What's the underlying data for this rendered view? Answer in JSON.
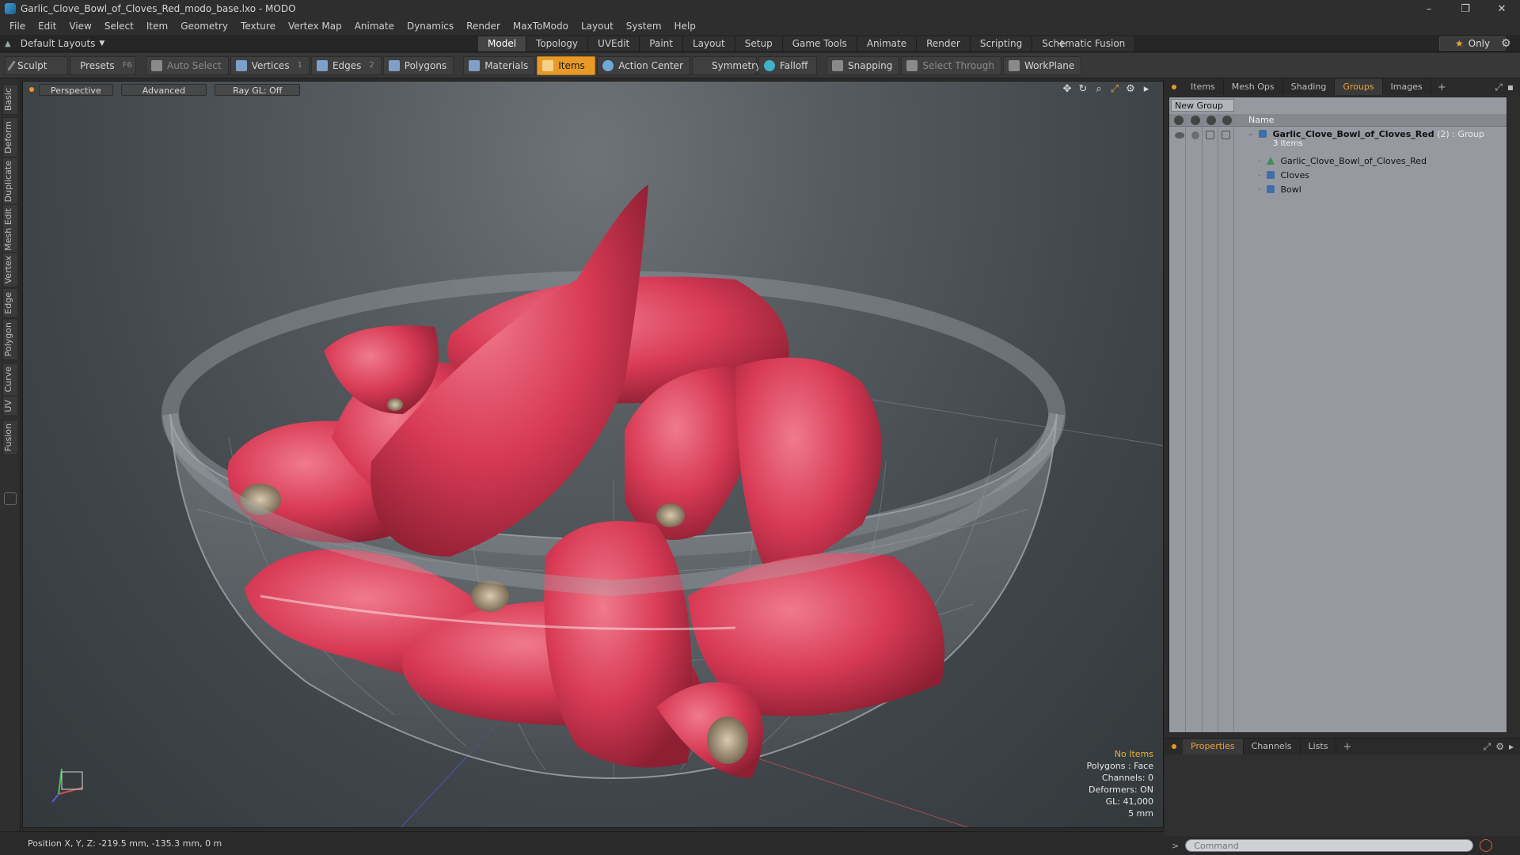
{
  "window": {
    "title": "Garlic_Clove_Bowl_of_Cloves_Red_modo_base.lxo - MODO",
    "controls": [
      "–",
      "❐",
      "✕"
    ]
  },
  "menu": [
    "File",
    "Edit",
    "View",
    "Select",
    "Item",
    "Geometry",
    "Texture",
    "Vertex Map",
    "Animate",
    "Dynamics",
    "Render",
    "MaxToModo",
    "Layout",
    "System",
    "Help"
  ],
  "layout": {
    "selector": "Default Layouts",
    "tabs": [
      "Model",
      "Topology",
      "UVEdit",
      "Paint",
      "Layout",
      "Setup",
      "Game Tools",
      "Animate",
      "Render",
      "Scripting",
      "Schematic Fusion"
    ],
    "active_tab": "Model",
    "only_label": "Only"
  },
  "toolbar": {
    "sculpt": "Sculpt",
    "presets": "Presets",
    "presets_shortcut": "F6",
    "auto_select": "Auto Select",
    "vertices": "Vertices",
    "vertices_count": "1",
    "edges": "Edges",
    "edges_count": "2",
    "polygons": "Polygons",
    "materials": "Materials",
    "items": "Items",
    "action_center": "Action Center",
    "symmetry": "Symmetry",
    "falloff": "Falloff",
    "snapping": "Snapping",
    "select_through": "Select Through",
    "workplane": "WorkPlane"
  },
  "left_tabs": [
    "Basic",
    "Deform",
    "Duplicate",
    "Mesh Edit",
    "Vertex",
    "Edge",
    "Polygon",
    "Curve",
    "UV",
    "Fusion"
  ],
  "viewport": {
    "view": "Perspective",
    "mode": "Advanced",
    "raygl": "Ray GL: Off",
    "info": {
      "selection": "No Items",
      "polygons": "Polygons : Face",
      "channels": "Channels: 0",
      "deformers": "Deformers: ON",
      "gl": "GL: 41,000",
      "scale": "5 mm"
    }
  },
  "status": {
    "position": "Position X, Y, Z:  -219.5 mm, -135.3 mm, 0 m"
  },
  "right_panel": {
    "tabs": [
      "Items",
      "Mesh Ops",
      "Shading",
      "Groups",
      "Images"
    ],
    "active_tab": "Groups",
    "new_group": "New Group",
    "column_name": "Name",
    "group": {
      "name": "Garlic_Clove_Bowl_of_Cloves_Red",
      "count": "(2)",
      "type": ": Group",
      "items_count": "3 Items",
      "children": [
        "Garlic_Clove_Bowl_of_Cloves_Red",
        "Cloves",
        "Bowl"
      ]
    },
    "bottom_tabs": [
      "Properties",
      "Channels",
      "Lists"
    ],
    "bottom_active": "Properties",
    "command_placeholder": "Command"
  },
  "colors": {
    "accent": "#e89a27",
    "clove_red": "#d83a55",
    "bowl_grey": "#7b8085"
  }
}
